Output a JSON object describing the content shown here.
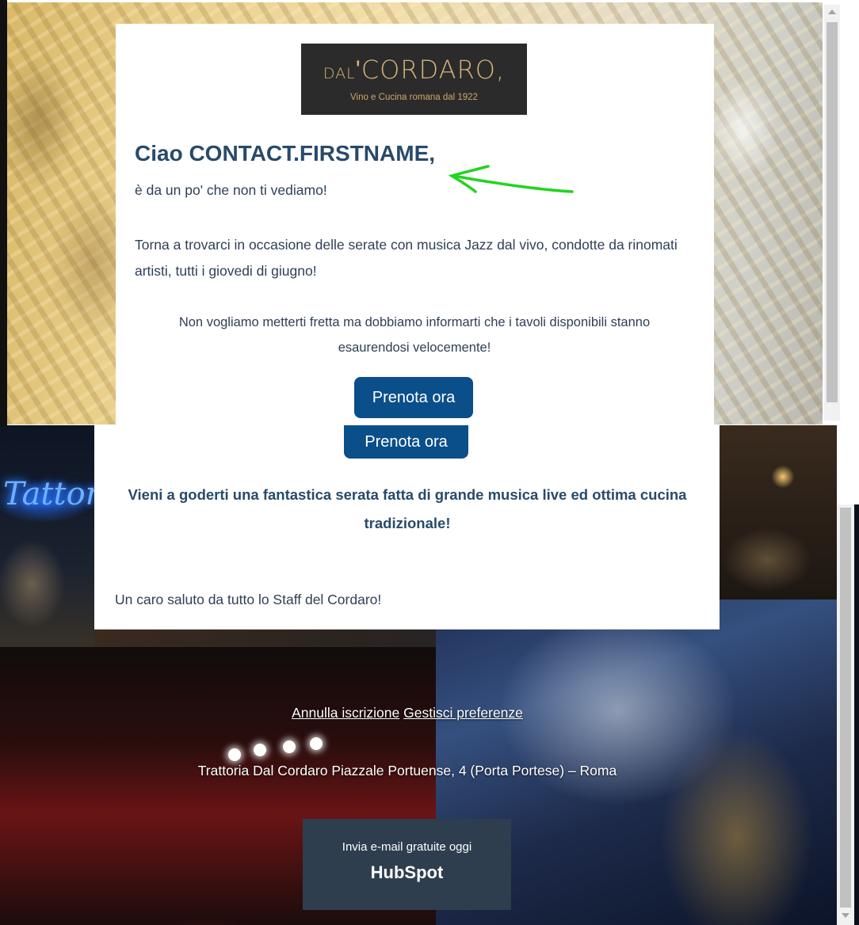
{
  "logo": {
    "prefix": "DAL",
    "name": "CORDARO",
    "tagline": "Vino e Cucina romana dal 1922"
  },
  "email": {
    "greeting": "Ciao CONTACT.FIRSTNAME,",
    "intro": "è da un po' che non ti vediamo!",
    "paragraph_1": "Torna a trovarci in occasione delle serate con musica Jazz dal vivo, condotte da rinomati artisti, tutti i giovedi di giugno!",
    "paragraph_2": "Non vogliamo metterti fretta ma dobbiamo informarti che i tavoli disponibili stanno esaurendosi velocemente!",
    "cta_label": "Prenota ora",
    "invite": "Vieni a goderti una fantastica serata fatta di grande musica live ed ottima cucina tradizionale!",
    "goodbye": "Un caro saluto da tutto lo Staff del Cordaro!"
  },
  "footer": {
    "unsubscribe": "Annulla iscrizione",
    "preferences": "Gestisci preferenze",
    "address": "Trattoria Dal Cordaro Piazzale Portuense, 4 (Porta Portese) – Roma",
    "hubspot_tagline": "Invia e-mail gratuite oggi",
    "hubspot_logo": "HubSpot"
  },
  "neon_sign": "Tattori",
  "colors": {
    "heading": "#284a6b",
    "button": "#0a4e8a",
    "annotation_arrow": "#22d41e",
    "hubspot_box": "#2e3e4e"
  }
}
